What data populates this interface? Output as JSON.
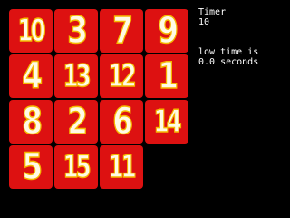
{
  "board": {
    "rows": 4,
    "cols": 4,
    "tiles": [
      "10",
      "3",
      "7",
      "9",
      "4",
      "13",
      "12",
      "1",
      "8",
      "2",
      "6",
      "14",
      "5",
      "15",
      "11",
      ""
    ],
    "colors": {
      "tile": "#dd1111",
      "digit_fill": "#fffbe6",
      "digit_outline": "#f5b800",
      "background": "#000000"
    }
  },
  "panel": {
    "timer_label": "Timer",
    "timer_value": "10",
    "low_time_label": "low time is",
    "low_time_value": "0.0 seconds"
  }
}
